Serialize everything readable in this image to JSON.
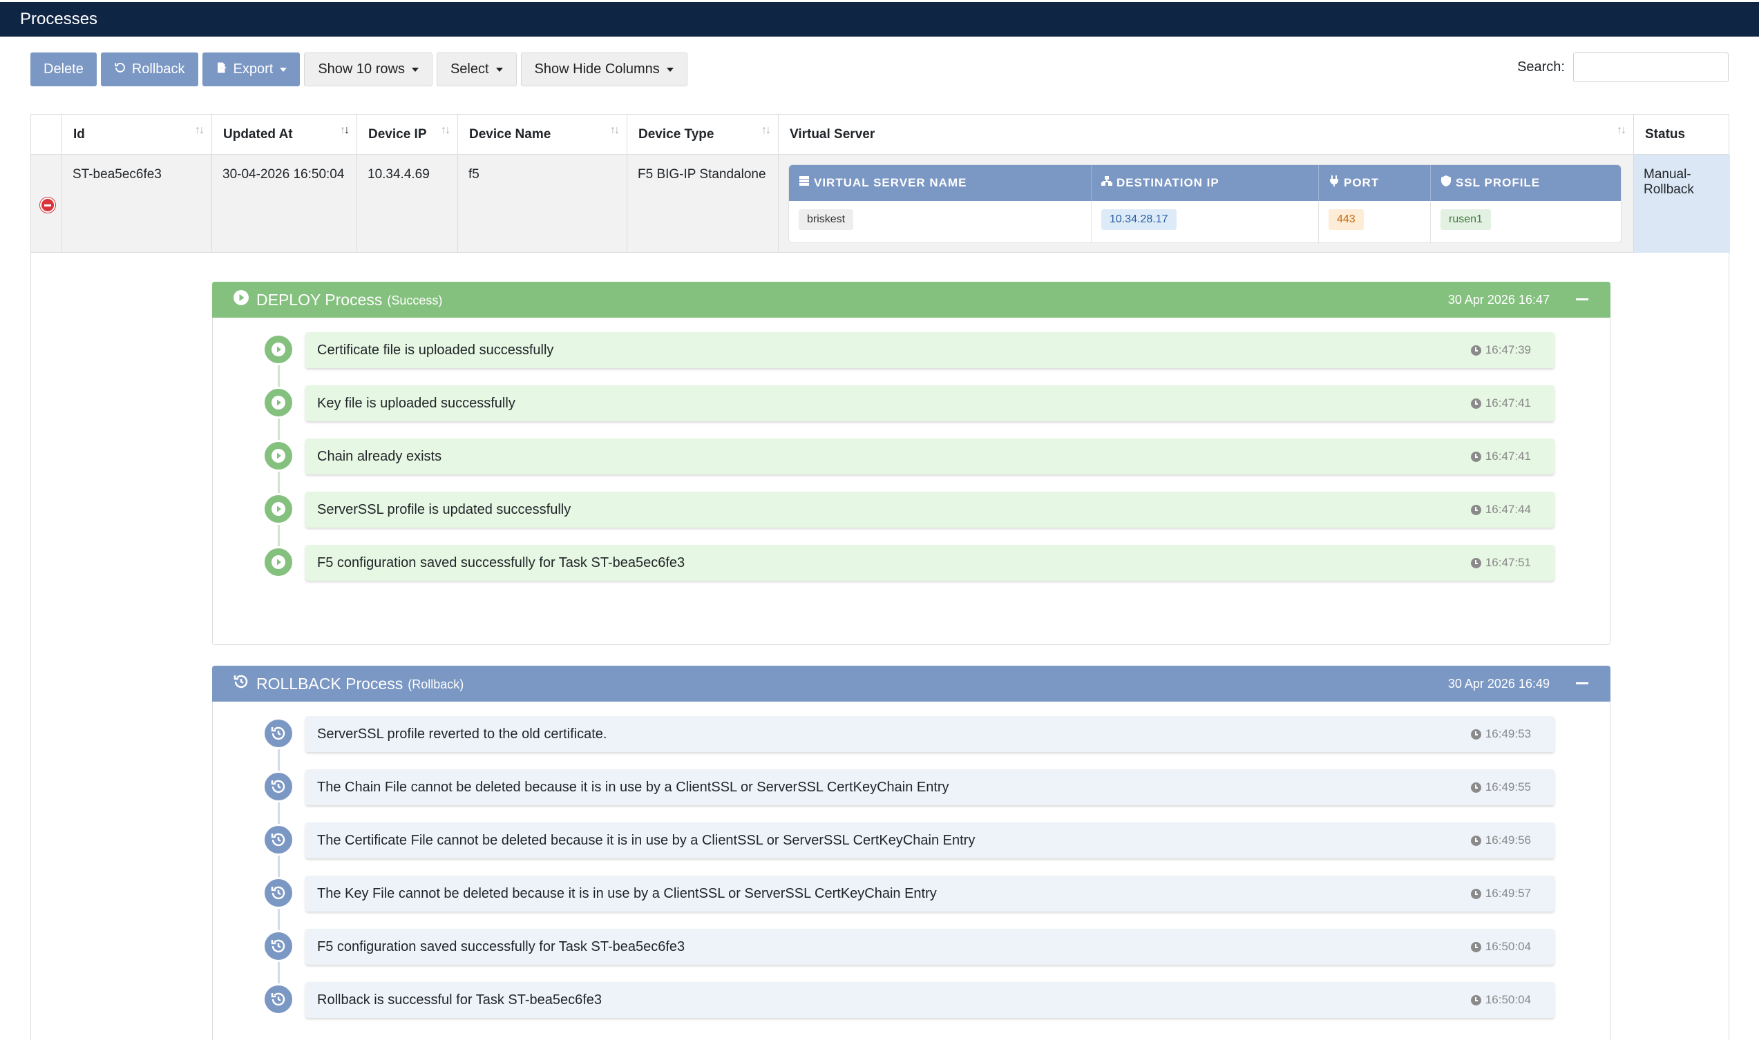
{
  "app": {
    "title": "Processes"
  },
  "toolbar": {
    "delete_label": "Delete",
    "rollback_label": "Rollback",
    "export_label": "Export",
    "show_rows_label": "Show 10 rows",
    "select_label": "Select",
    "columns_label": "Show Hide Columns"
  },
  "search": {
    "label": "Search:",
    "value": ""
  },
  "table": {
    "columns": [
      "Id",
      "Updated At",
      "Device IP",
      "Device Name",
      "Device Type",
      "Virtual Server",
      "Status"
    ],
    "row": {
      "id": "ST-bea5ec6fe3",
      "updated_at": "30-04-2026 16:50:04",
      "device_ip": "10.34.4.69",
      "device_name": "f5",
      "device_type": "F5 BIG-IP Standalone",
      "status": "Manual-Rollback"
    },
    "virtual_server": {
      "headers": [
        "VIRTUAL SERVER NAME",
        "DESTINATION IP",
        "PORT",
        "SSL PROFILE"
      ],
      "values": [
        "briskest",
        "10.34.28.17",
        "443",
        "rusen1"
      ]
    }
  },
  "deploy": {
    "title": "DEPLOY Process",
    "subtitle": "(Success)",
    "date": "30 Apr 2026 16:47",
    "color": "#84c07e",
    "steps": [
      {
        "text": "Certificate file is uploaded successfully",
        "time": "16:47:39"
      },
      {
        "text": "Key file is uploaded successfully",
        "time": "16:47:41"
      },
      {
        "text": "Chain already exists",
        "time": "16:47:41"
      },
      {
        "text": "ServerSSL profile is updated successfully",
        "time": "16:47:44"
      },
      {
        "text": "F5 configuration saved successfully for Task ST-bea5ec6fe3",
        "time": "16:47:51"
      }
    ]
  },
  "rollback": {
    "title": "ROLLBACK Process",
    "subtitle": "(Rollback)",
    "date": "30 Apr 2026 16:49",
    "color": "#7b97c3",
    "steps": [
      {
        "text": "ServerSSL profile reverted to the old certificate.",
        "time": "16:49:53"
      },
      {
        "text": "The Chain File cannot be deleted because it is in use by a ClientSSL or ServerSSL CertKeyChain Entry",
        "time": "16:49:55"
      },
      {
        "text": "The Certificate File cannot be deleted because it is in use by a ClientSSL or ServerSSL CertKeyChain Entry",
        "time": "16:49:56"
      },
      {
        "text": "The Key File cannot be deleted because it is in use by a ClientSSL or ServerSSL CertKeyChain Entry",
        "time": "16:49:57"
      },
      {
        "text": "F5 configuration saved successfully for Task ST-bea5ec6fe3",
        "time": "16:50:04"
      },
      {
        "text": "Rollback is successful for Task ST-bea5ec6fe3",
        "time": "16:50:04"
      }
    ]
  }
}
